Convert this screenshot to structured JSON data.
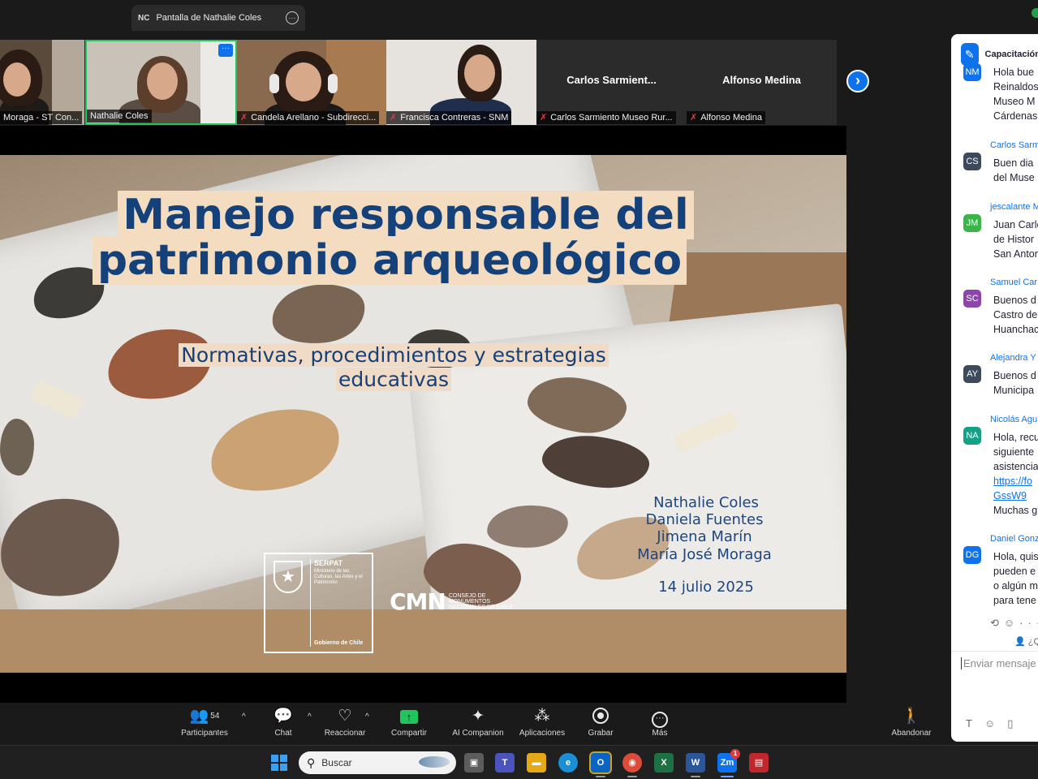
{
  "top_bar": {
    "share_badge": "NC",
    "share_title": "Pantalla de Nathalie Coles",
    "options_icon": "more-options-icon"
  },
  "gallery": {
    "participants": [
      {
        "label": "Moraga - ST Con...",
        "muted": false,
        "type": "video"
      },
      {
        "label": "Nathalie Coles",
        "muted": false,
        "type": "video",
        "active": true
      },
      {
        "label": "Candela Arellano - Subdirecci...",
        "muted": true,
        "type": "video"
      },
      {
        "label": "Francisca Contreras - SNM",
        "muted": true,
        "type": "video"
      },
      {
        "label": "Carlos Sarmiento Museo Rur...",
        "display_name": "Carlos  Sarmient...",
        "muted": true,
        "type": "name"
      },
      {
        "label": "Alfonso Medina",
        "display_name": "Alfonso Medina",
        "muted": true,
        "type": "name"
      }
    ],
    "next_icon": "chevron-right-icon"
  },
  "slide": {
    "title_line1": "Manejo responsable del",
    "title_line2": "patrimonio arqueológico",
    "subtitle_line1": "Normativas, procedimientos y estrategias",
    "subtitle_line2": "educativas",
    "authors": [
      "Nathalie Coles",
      "Daniela Fuentes",
      "Jimena Marín",
      "María José Moraga"
    ],
    "date": "14 julio 2025",
    "serpat": {
      "name": "SERPAT",
      "ministry": "Ministerio de las Culturas, las Artes y el Patrimonio",
      "government": "Gobierno de Chile"
    },
    "cmn": {
      "acronym": "CMN",
      "full_name": "CONSEJO DE MONUMENTOS NACIONALES DE CHILE"
    }
  },
  "chat": {
    "title": "Capacitación",
    "messages": [
      {
        "sender": "",
        "initials": "NM",
        "color": "#0e72ed",
        "lines": [
          "Hola bue",
          "Reinaldos",
          "Museo M",
          "Cárdenas"
        ]
      },
      {
        "sender": "Carlos Sarm",
        "initials": "CS",
        "color": "#3d4a5c",
        "lines": [
          "Buen dia",
          "del Muse"
        ]
      },
      {
        "sender": "jescalante M",
        "initials": "JM",
        "color": "#3bb54a",
        "lines": [
          "Juan Carlo",
          "de Histor",
          "San Anton"
        ]
      },
      {
        "sender": "Samuel Car",
        "initials": "SC",
        "color": "#8e44ad",
        "lines": [
          "Buenos d",
          "Castro de",
          "Huanchac"
        ]
      },
      {
        "sender": "Alejandra Y",
        "initials": "AY",
        "color": "#3d4a5c",
        "lines": [
          "Buenos d",
          "Municipa"
        ]
      },
      {
        "sender": "Nicolás Agu",
        "initials": "NA",
        "color": "#16a085",
        "lines": [
          "Hola, recu",
          "siguiente",
          "asistencia"
        ],
        "link_lines": [
          "https://fo",
          "GssW9"
        ],
        "after_lines": [
          "Muchas g"
        ]
      },
      {
        "sender": "Daniel Gonz",
        "initials": "DG",
        "color": "#0e72ed",
        "lines": [
          "Hola, quis",
          "pueden e",
          "o algún m",
          "para tene"
        ]
      }
    ],
    "reply_hint": "¿Q",
    "input_placeholder": "Enviar mensaje a"
  },
  "toolbar": {
    "participants_label": "Participantes",
    "participants_count": "54",
    "chat_label": "Chat",
    "react_label": "Reaccionar",
    "share_label": "Compartir",
    "ai_label": "AI Companion",
    "apps_label": "Aplicaciones",
    "record_label": "Grabar",
    "more_label": "Más",
    "leave_label": "Abandonar"
  },
  "taskbar": {
    "search_placeholder": "Buscar",
    "zoom_badge": "1"
  }
}
